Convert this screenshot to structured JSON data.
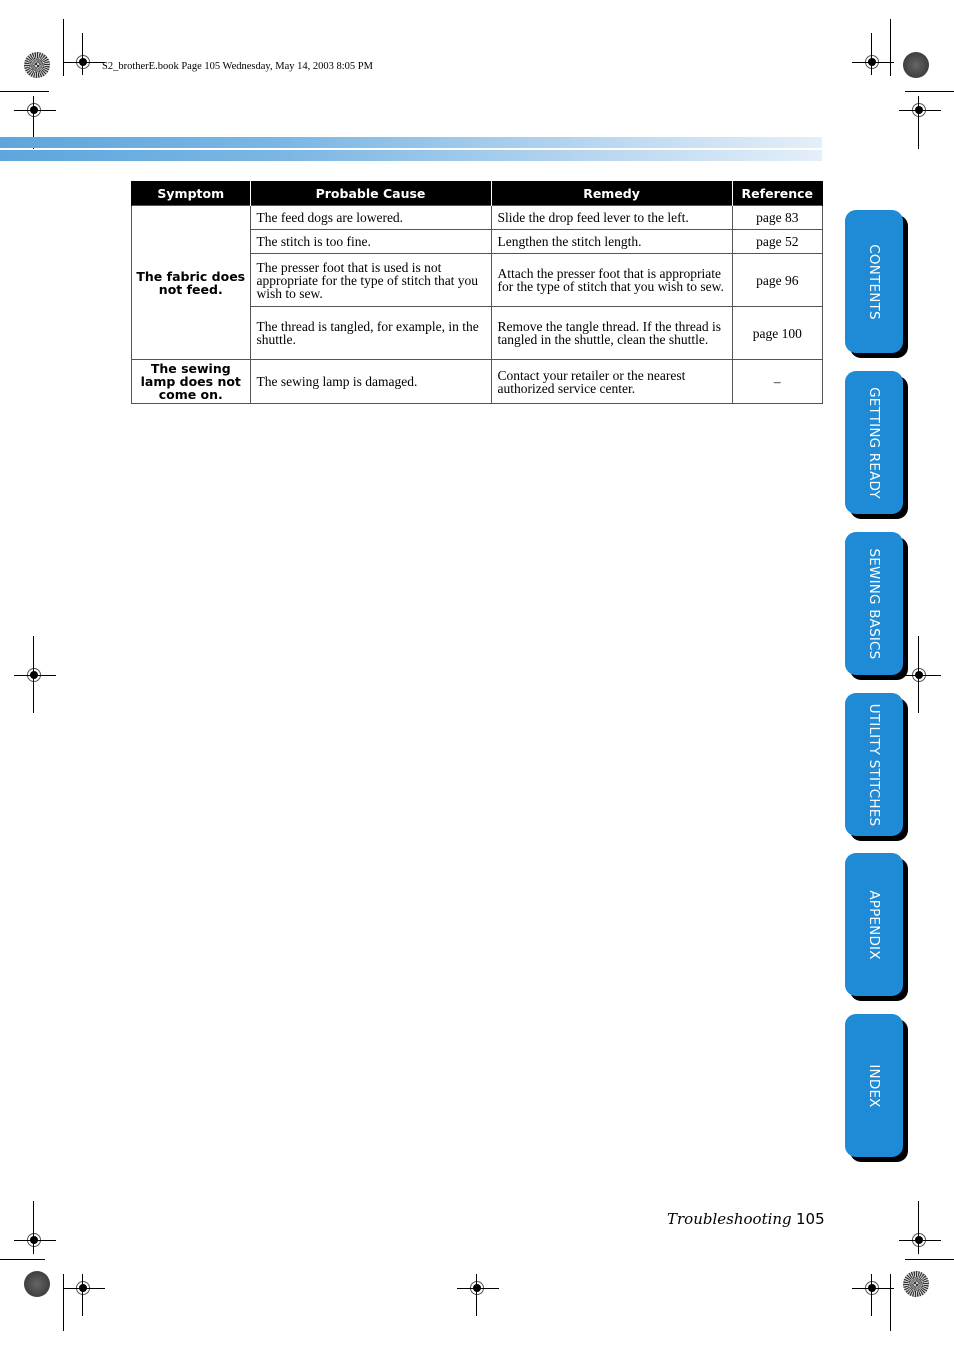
{
  "slug": "S2_brotherE.book  Page 105  Wednesday, May 14, 2003  8:05 PM",
  "table": {
    "headers": [
      "Symptom",
      "Probable Cause",
      "Remedy",
      "Reference"
    ],
    "groups": [
      {
        "symptom": "The fabric does not feed.",
        "rows": [
          {
            "cause": "The feed dogs are lowered.",
            "remedy": "Slide the drop feed lever to the left.",
            "reference": "page 83"
          },
          {
            "cause": "The stitch is too fine.",
            "remedy": "Lengthen the stitch length.",
            "reference": "page 52"
          },
          {
            "cause": "The presser foot that is used is not appropriate for the type of stitch that you wish to sew.",
            "remedy": "Attach the presser foot that is appropriate for the type of stitch that you wish to sew.",
            "reference": "page 96"
          },
          {
            "cause": "The thread is tangled, for example, in the shuttle.",
            "remedy": "Remove the tangle thread. If the thread is tangled in the shuttle, clean the shuttle.",
            "reference": "page 100"
          }
        ]
      },
      {
        "symptom": "The sewing lamp does not come on.",
        "rows": [
          {
            "cause": "The sewing lamp is damaged.",
            "remedy": "Contact your retailer or the nearest authorized service center.",
            "reference": "–"
          }
        ]
      }
    ]
  },
  "side_tabs": [
    {
      "label": "CONTENTS"
    },
    {
      "label": "GETTING READY"
    },
    {
      "label": "SEWING BASICS"
    },
    {
      "label": "UTILITY STITCHES"
    },
    {
      "label": "APPENDIX"
    },
    {
      "label": "INDEX"
    }
  ],
  "footer": {
    "section": "Troubleshooting",
    "page": "105"
  },
  "colors": {
    "tab_blue": "#1f8ad6",
    "header_bar_start": "#5ea6dc",
    "header_bar_end": "#e4eff9"
  }
}
